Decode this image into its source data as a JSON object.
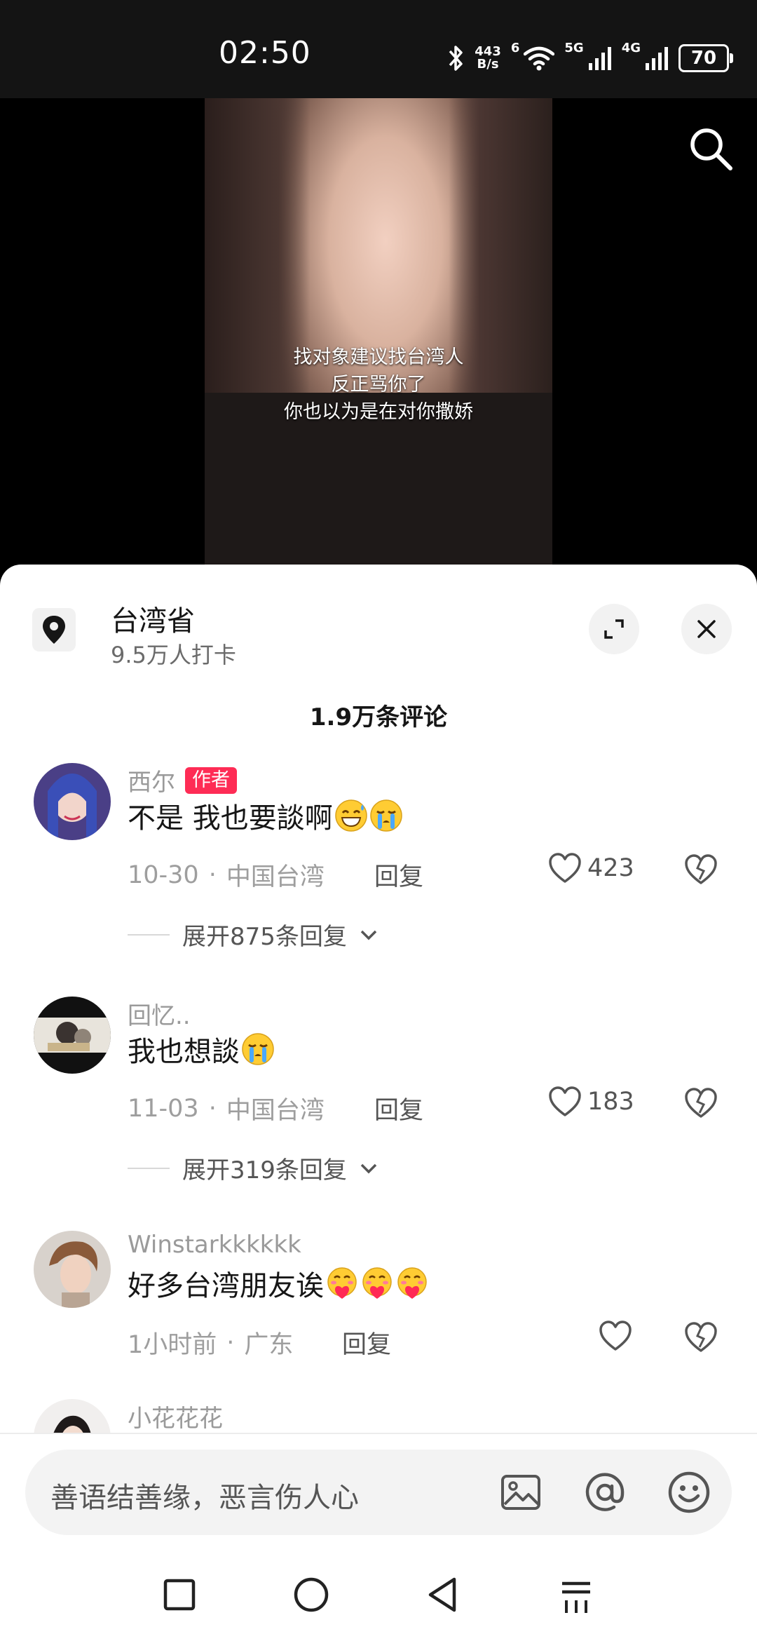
{
  "status_bar": {
    "time": "02:50",
    "net_speed_value": "443",
    "net_speed_unit": "B/s",
    "wifi_label": "6",
    "signal1_label": "5G",
    "signal2_label": "4G",
    "battery": "70"
  },
  "video": {
    "subtitles": [
      "找对象建议找台湾人",
      "反正骂你了",
      "你也以为是在对你撒娇"
    ]
  },
  "location": {
    "title": "台湾省",
    "subtitle": "9.5万人打卡"
  },
  "comments_header": {
    "count": "1.9万条评论"
  },
  "comments": [
    {
      "username": "西尔",
      "badge": "作者",
      "text": "不是 我也要談啊",
      "emojis": [
        "grin-sweat-emoji",
        "crying-emoji"
      ],
      "date": "10-30",
      "location": "中国台湾",
      "reply_label": "回复",
      "likes": "423",
      "expand_label": "展开875条回复"
    },
    {
      "username": "回忆..",
      "text": "我也想談",
      "emojis": [
        "crying-emoji"
      ],
      "date": "11-03",
      "location": "中国台湾",
      "reply_label": "回复",
      "likes": "183",
      "expand_label": "展开319条回复"
    },
    {
      "username": "Winstarkkkkkk",
      "text": "好多台湾朋友诶",
      "emojis": [
        "heart-hug-emoji",
        "heart-hug-emoji",
        "heart-hug-emoji"
      ],
      "date": "1小时前",
      "location": "广东",
      "reply_label": "回复",
      "likes": ""
    },
    {
      "username": "小花花花"
    }
  ],
  "input": {
    "placeholder": "善语结善缘，恶言伤人心"
  },
  "colors": {
    "accent": "#fe2c55",
    "text": "#161616",
    "muted": "#9a9a9a"
  }
}
